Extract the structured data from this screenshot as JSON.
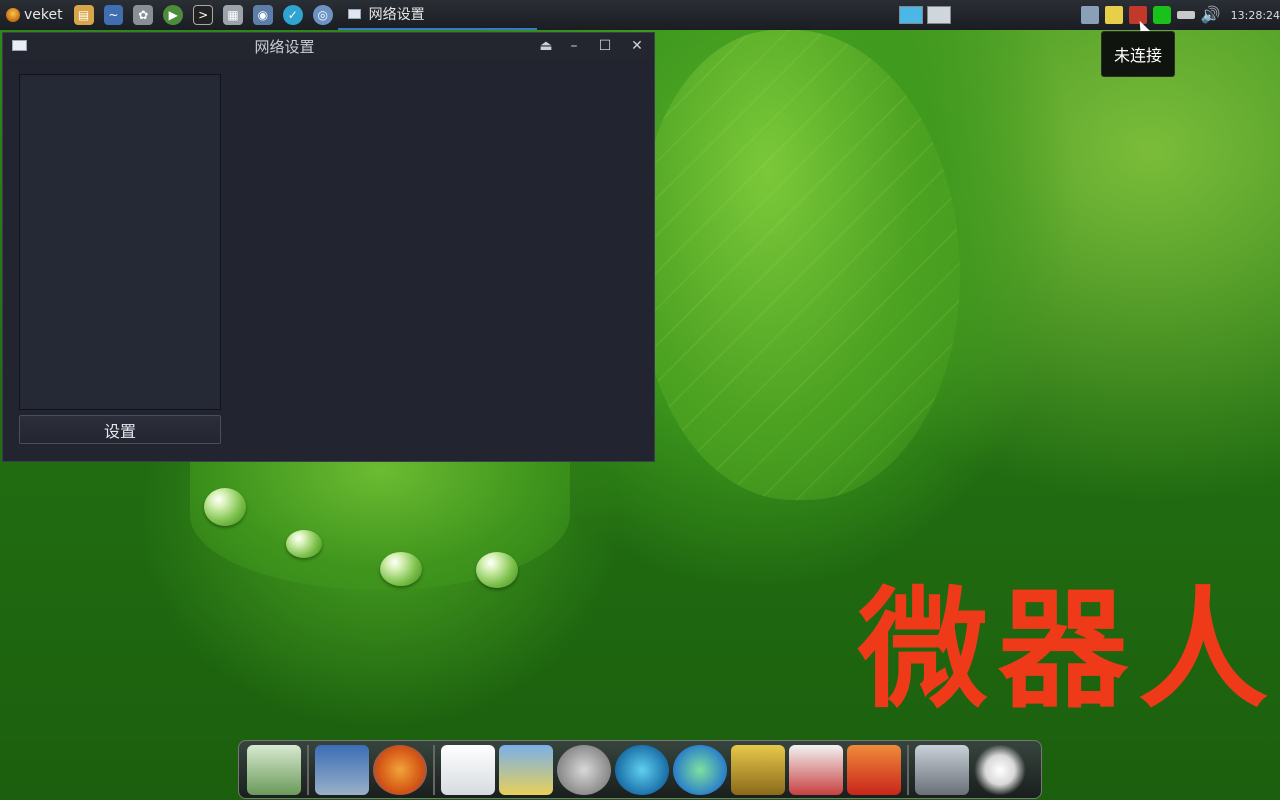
{
  "panel": {
    "start_label": "veket",
    "quick_launch": [
      "folder-icon",
      "monitor-icon",
      "settings-icon",
      "play-icon",
      "terminal-icon",
      "printer-icon",
      "camera-icon",
      "clock-icon",
      "network-icon"
    ],
    "task_title": "网络设置",
    "workspaces": [
      {
        "active": true
      },
      {
        "active": false
      }
    ],
    "clock": "13:28:24"
  },
  "tooltip": {
    "text": "未连接"
  },
  "window": {
    "title": "网络设置",
    "set_button": "设置",
    "controls": [
      "eject-icon",
      "minimize-icon",
      "maximize-icon",
      "close-icon"
    ]
  },
  "wallpaper": {
    "brand_text": "微器人"
  },
  "dock": {
    "items": [
      "leaf-app-icon",
      "computer-icon",
      "firefox-icon",
      "notepad-icon",
      "image-viewer-icon",
      "music-player-icon",
      "atom-icon",
      "media-play-icon",
      "door-exit-icon",
      "chart-icon",
      "rocket-icon",
      "drive-icon",
      "brightness-icon"
    ]
  },
  "colors": {
    "panel": "#1a1d22",
    "window": "#22242f",
    "brand": "#ef3a1a",
    "tooltip": "#10140f",
    "accent": "#3a78c8"
  }
}
